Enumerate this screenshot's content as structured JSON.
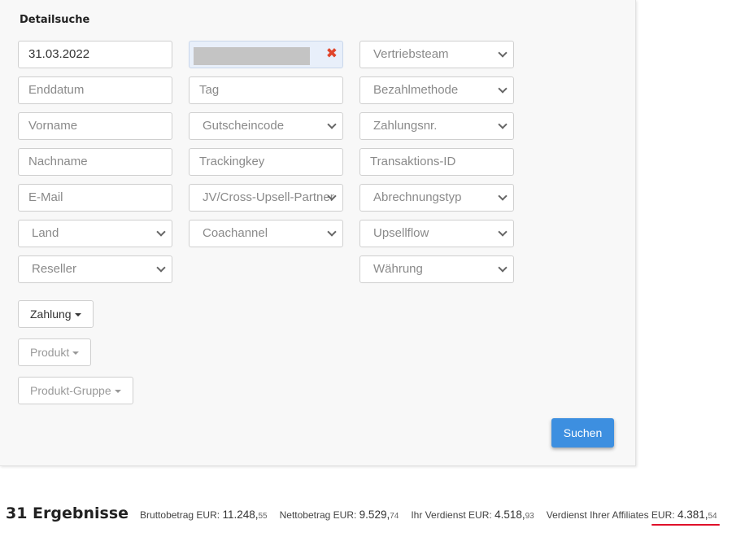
{
  "panel": {
    "title": "Detailsuche"
  },
  "column1": {
    "start_date_value": "31.03.2022",
    "end_date_placeholder": "Enddatum",
    "firstname_placeholder": "Vorname",
    "lastname_placeholder": "Nachname",
    "email_placeholder": "E-Mail",
    "country_select": "Land",
    "reseller_select": "Reseller"
  },
  "column2": {
    "clear_symbol": "✖",
    "tag_placeholder": "Tag",
    "coupon_select": "Gutscheincode",
    "trackingkey_placeholder": "Trackingkey",
    "jv_select": "JV/Cross-Upsell-Partner",
    "coachannel_select": "Coachannel"
  },
  "column3": {
    "salesteam_select": "Vertriebsteam",
    "payment_method_select": "Bezahlmethode",
    "payment_no_select": "Zahlungsnr.",
    "transaction_id_placeholder": "Transaktions-ID",
    "billing_type_select": "Abrechnungstyp",
    "upsellflow_select": "Upsellflow",
    "currency_select": "Währung"
  },
  "filters": {
    "payment_label": "Zahlung",
    "product_label": "Produkt",
    "product_group_label": "Produkt-Gruppe"
  },
  "search_button": "Suchen",
  "summary": {
    "results_label": "31 Ergebnisse",
    "gross_label": "Bruttobetrag EUR:",
    "gross_main": "11.248,",
    "gross_cents": "55",
    "net_label": "Nettobetrag EUR:",
    "net_main": "9.529,",
    "net_cents": "74",
    "earnings_label": "Ihr Verdienst EUR:",
    "earnings_main": "4.518,",
    "earnings_cents": "93",
    "affiliates_label": "Verdienst Ihrer Affiliates EUR:",
    "affiliates_main": "4.381,",
    "affiliates_cents": "54"
  },
  "colors": {
    "primary_button": "#3d8fe0",
    "highlight_underline": "#e0102a",
    "clear_icon": "#e0452b"
  }
}
